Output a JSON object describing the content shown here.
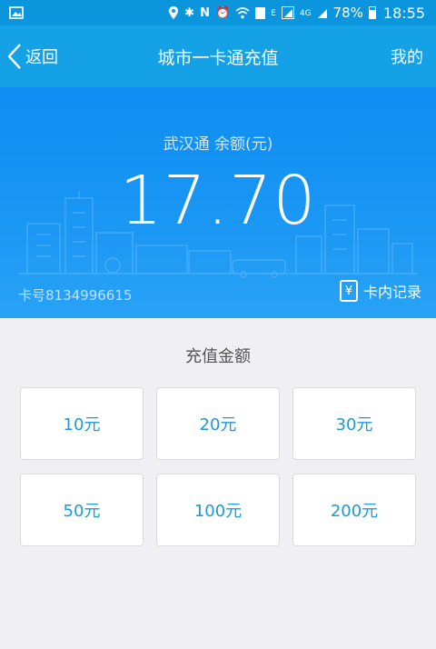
{
  "status_bar": {
    "network_indicator": "E",
    "network_type": "4G",
    "battery": "78%",
    "time": "18:55",
    "icons": [
      "image-icon",
      "location-icon",
      "bluetooth-icon",
      "nfc-icon",
      "alarm-icon",
      "wifi-icon",
      "sim-icon",
      "signal-icon",
      "battery-icon"
    ]
  },
  "nav": {
    "back_label": "返回",
    "title": "城市一卡通充值",
    "mine_label": "我的"
  },
  "card": {
    "balance_label": "武汉通 余额(元)",
    "balance_amount": "17.70",
    "card_number": "卡号8134996615",
    "records_label": "卡内记录",
    "records_icon": "¥"
  },
  "recharge": {
    "title": "充值金额",
    "options": [
      "10元",
      "20元",
      "30元",
      "50元",
      "100元",
      "200元"
    ]
  },
  "colors": {
    "status_bar": "#0a95dd",
    "nav_bar": "#14a1e6",
    "card_gradient_top": "#0d8ef3",
    "card_gradient_bottom": "#28a3f6",
    "accent_text": "#1a9ad6",
    "page_background": "#efeff4"
  }
}
